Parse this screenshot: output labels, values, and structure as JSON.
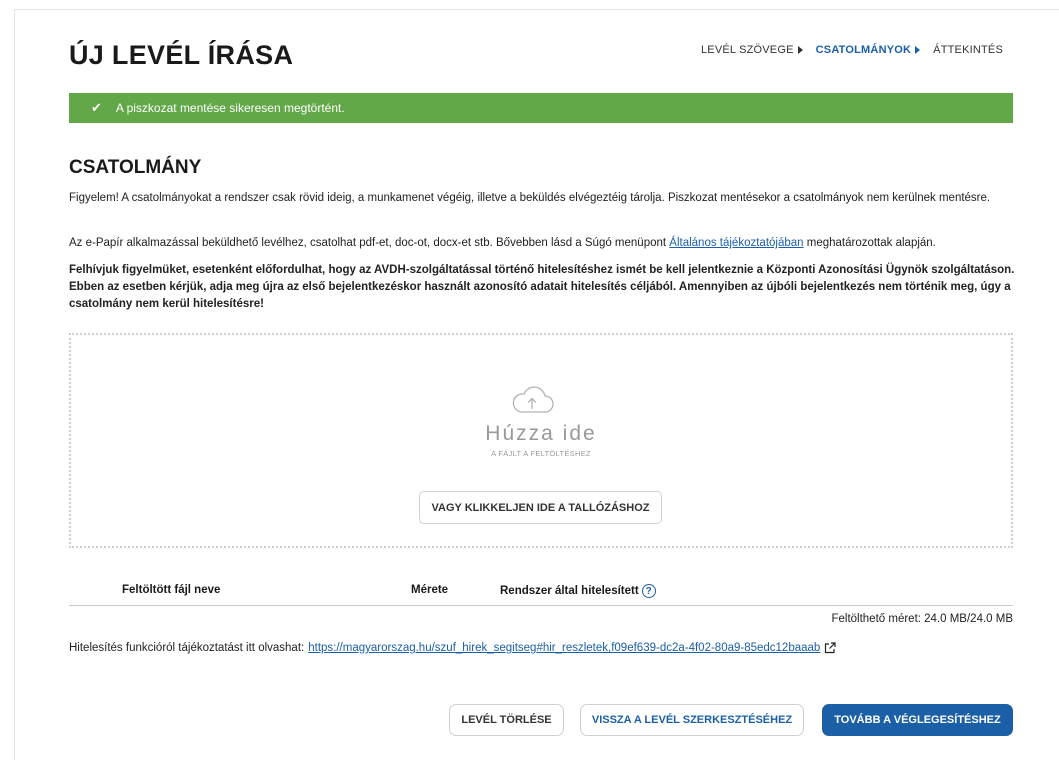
{
  "page_title": "ÚJ LEVÉL ÍRÁSA",
  "steps": [
    {
      "label": "LEVÉL SZÖVEGE",
      "active": false
    },
    {
      "label": "CSATOLMÁNYOK",
      "active": true
    },
    {
      "label": "ÁTTEKINTÉS",
      "active": false
    }
  ],
  "alert": {
    "text": "A piszkozat mentése sikeresen megtörtént.",
    "color": "#62a748"
  },
  "section_title": "CSATOLMÁNY",
  "paragraphs": {
    "p1": "Figyelem! A csatolmányokat a rendszer csak rövid ideig, a munkamenet végéig, illetve a beküldés elvégeztéig tárolja. Piszkozat mentésekor a csatolmányok nem kerülnek mentésre.",
    "p2_before": "Az e-Papír alkalmazással beküldhető levélhez, csatolhat pdf-et, doc-ot, docx-et stb. Bővebben lásd a Súgó menüpont ",
    "p2_link": "Általános tájékoztatójában",
    "p2_after": " meghatározottak alapján.",
    "p3": "Felhívjuk figyelmüket, esetenként előfordulhat, hogy az AVDH-szolgáltatással történő hitelesítéshez ismét be kell jelentkeznie a Központi Azonosítási Ügynök szolgáltatáson. Ebben az esetben kérjük, adja meg újra az első bejelentkezéskor használt azonosító adatait hitelesítés céljából. Amennyiben az újbóli bejelentkezés nem történik meg, úgy a csatolmány nem kerül hitelesítésre!"
  },
  "dropzone": {
    "main_text": "Húzza ide",
    "sub_text": "A FÁJLT A FELTÖLTÉSHEZ",
    "browse_label": "VAGY KLIKKELJEN IDE A TALLÓZÁSHOZ",
    "icon": "cloud-upload-icon"
  },
  "table": {
    "headers": [
      "Feltöltött fájl neve",
      "Mérete",
      "Rendszer által hitelesített"
    ],
    "rows": []
  },
  "upload_size": "Feltölthető méret: 24.0 MB/24.0 MB",
  "info": {
    "text": "Hitelesítés funkcióról tájékoztatást itt olvashat: ",
    "link": "https://magyarorszag.hu/szuf_hirek_segitseg#hir_reszletek,f09ef639-dc2a-4f02-80a9-85edc12baaab"
  },
  "buttons": {
    "delete": "LEVÉL TÖRLÉSE",
    "back": "VISSZA A LEVÉL SZERKESZTÉSÉHEZ",
    "next": "TOVÁBB A VÉGLEGESÍTÉSHEZ"
  },
  "colors": {
    "accent": "#1c5fa8",
    "primary_button": "#1b5fa6",
    "success": "#62a748"
  }
}
